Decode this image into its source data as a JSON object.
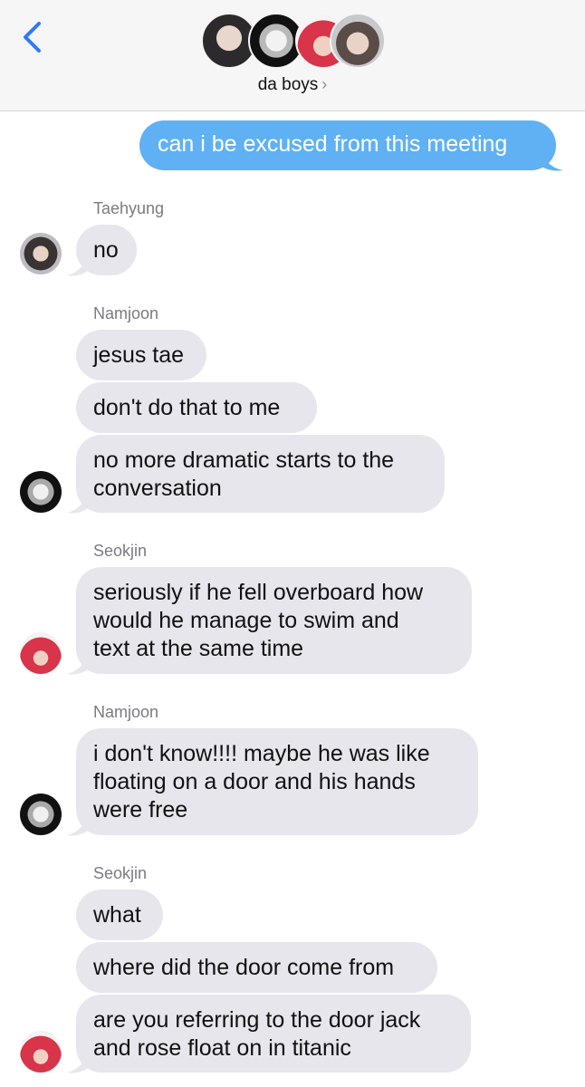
{
  "header": {
    "title": "da boys",
    "chevron": "›",
    "accent": "#3478f6",
    "group_avatars": [
      "photo-avatar-1",
      "photo-avatar-2",
      "photo-avatar-3",
      "photo-avatar-4"
    ]
  },
  "colors": {
    "outgoing_bubble": "#5fb1f4",
    "incoming_bubble": "#e6e6ec",
    "sender_name": "#7b7b80"
  },
  "messages": {
    "m1": "can i be excused from this meeting",
    "m2": "no",
    "m3": "jesus tae",
    "m4": "don't do that to me",
    "m5a": "no more dramatic starts to the",
    "m5b": "conversation",
    "m6a": "seriously if he fell overboard how",
    "m6b": "would he manage to swim and",
    "m6c": "text at the same time",
    "m7a": "i don't know!!!! maybe he was like",
    "m7b": "floating on a door and his hands",
    "m7c": "were free",
    "m8": "what",
    "m9": "where did the door come from",
    "m10a": "are you referring to the door jack",
    "m10b": "and rose float on in titanic"
  },
  "senders": {
    "s1": "Taehyung",
    "s2": "Namjoon",
    "s3": "Seokjin",
    "s4": "Namjoon",
    "s5": "Seokjin"
  }
}
